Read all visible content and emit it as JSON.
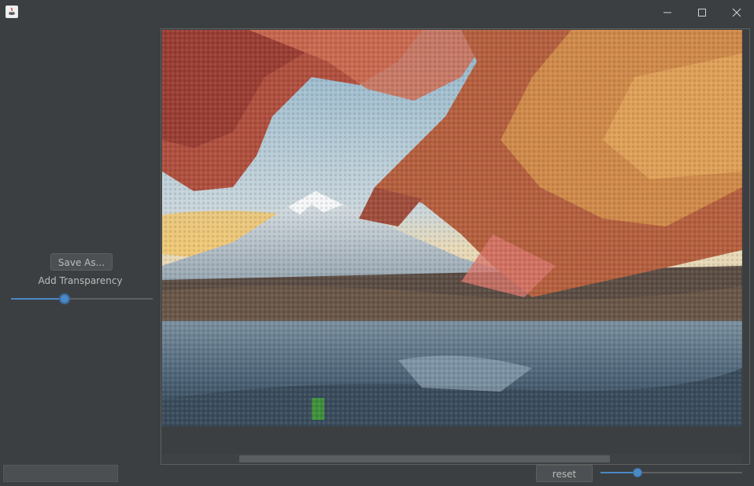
{
  "window": {
    "icon": "java-app-icon",
    "controls": [
      "minimize-icon",
      "maximize-icon",
      "close-icon"
    ]
  },
  "left_panel": {
    "save_label": "Save As...",
    "transparency_label": "Add Transparency",
    "transparency_value": 0.38
  },
  "canvas": {
    "image": "mosaic-mount-fuji-autumn-leaves",
    "hscroll_position": 0.33
  },
  "bottom_bar": {
    "status_text": "",
    "reset_label": "reset",
    "zoom_value": 0.26
  },
  "colors": {
    "background": "#3c3f41",
    "accent": "#4a88c7"
  }
}
